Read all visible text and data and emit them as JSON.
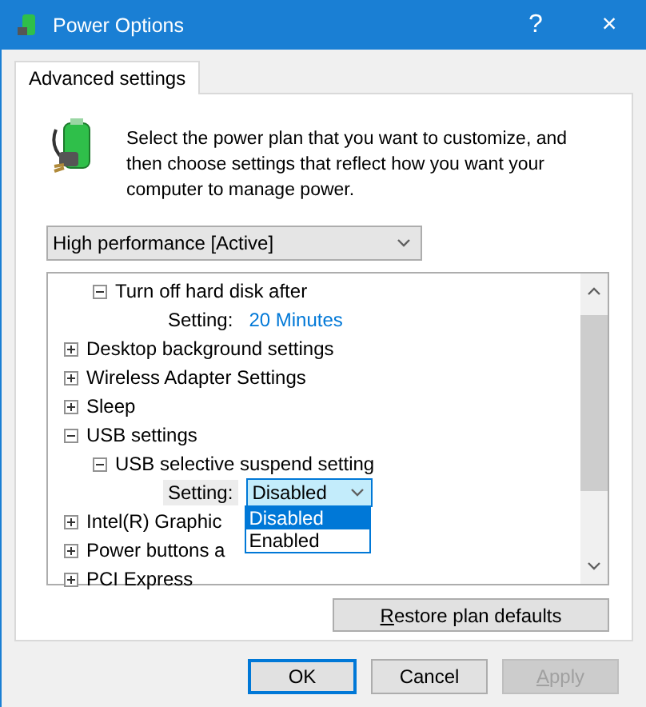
{
  "window": {
    "title": "Power Options",
    "help": "?",
    "close": "×"
  },
  "tabs": [
    {
      "label": "Advanced settings",
      "selected": true
    }
  ],
  "intro": "Select the power plan that you want to customize, and then choose settings that reflect how you want your computer to manage power.",
  "plan": {
    "value": "High performance [Active]"
  },
  "tree": [
    {
      "children": [
        {
          "label": "Turn off hard disk after",
          "expanded": true,
          "children": [
            {
              "kind": "setting",
              "label": "Setting:",
              "value": "20 Minutes"
            }
          ]
        }
      ]
    },
    {
      "label": "Desktop background settings",
      "expanded": false
    },
    {
      "label": "Wireless Adapter Settings",
      "expanded": false
    },
    {
      "label": "Sleep",
      "expanded": false
    },
    {
      "label": "USB settings",
      "expanded": true,
      "children": [
        {
          "label": "USB selective suspend setting",
          "expanded": true,
          "children": [
            {
              "kind": "select",
              "label": "Setting:",
              "value": "Disabled",
              "open": true,
              "options": [
                {
                  "label": "Disabled",
                  "selected": true
                },
                {
                  "label": "Enabled",
                  "selected": false
                }
              ]
            }
          ]
        }
      ]
    },
    {
      "label": "Intel(R) Graphic",
      "expanded": false
    },
    {
      "label": "Power buttons a",
      "expanded": false
    },
    {
      "label": "PCI Express",
      "expanded": false
    }
  ],
  "restore": {
    "label": "Restore plan defaults",
    "underline_first": true
  },
  "buttons": [
    {
      "label": "OK",
      "default": true,
      "disabled": false,
      "underline_first": false
    },
    {
      "label": "Cancel",
      "default": false,
      "disabled": false,
      "underline_first": false
    },
    {
      "label": "Apply",
      "default": false,
      "disabled": true,
      "underline_first": true
    }
  ]
}
